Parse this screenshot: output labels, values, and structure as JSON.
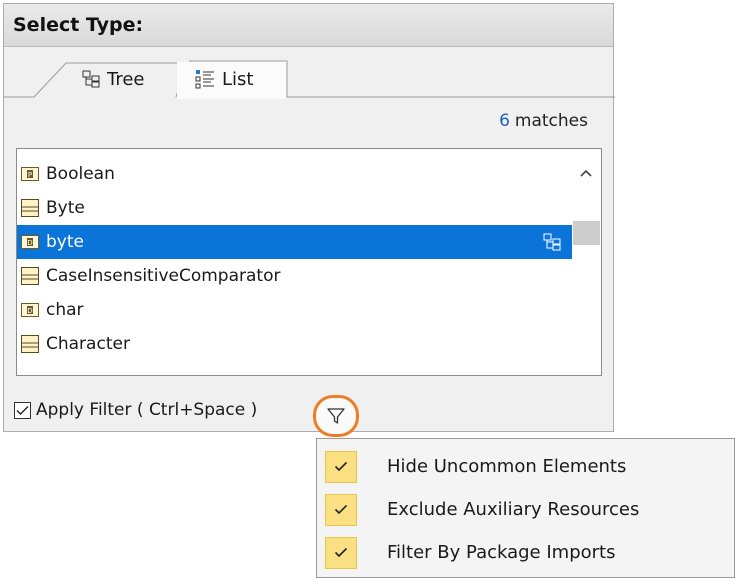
{
  "dialog": {
    "title": "Select Type:"
  },
  "tabs": [
    {
      "label": "Tree",
      "icon": "tree-icon",
      "active": false
    },
    {
      "label": "List",
      "icon": "list-icon",
      "active": true
    }
  ],
  "matches": {
    "count": "6",
    "label": "matches"
  },
  "list": {
    "items": [
      {
        "label": "Boolean",
        "icon": "primitive-type-icon"
      },
      {
        "label": "Byte",
        "icon": "class-icon"
      },
      {
        "label": "byte",
        "icon": "data-type-icon",
        "selected": true
      },
      {
        "label": "CaseInsensitiveComparator",
        "icon": "class-icon"
      },
      {
        "label": "char",
        "icon": "data-type-icon"
      },
      {
        "label": "Character",
        "icon": "class-icon"
      }
    ]
  },
  "footer": {
    "apply_filter_label": "Apply Filter ( Ctrl+Space )",
    "apply_filter_checked": true
  },
  "filter_menu": {
    "items": [
      {
        "label": "Hide Uncommon Elements",
        "checked": true
      },
      {
        "label": "Exclude Auxiliary Resources",
        "checked": true
      },
      {
        "label": "Filter By Package Imports",
        "checked": true
      }
    ]
  },
  "colors": {
    "selection": "#0a74d9",
    "filter_highlight": "#f07b25",
    "match_count": "#1f5fbf",
    "menu_check_bg": "#fbe083"
  }
}
